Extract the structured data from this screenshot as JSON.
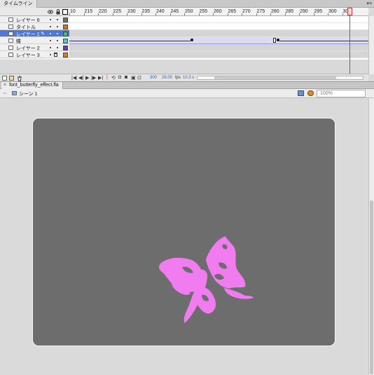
{
  "timeline": {
    "tab_title": "タイムライン",
    "panel_menu": "▾≡",
    "ruler_labels": [
      "10",
      "215",
      "220",
      "225",
      "230",
      "235",
      "240",
      "245",
      "250",
      "255",
      "260",
      "265",
      "270",
      "275",
      "280",
      "285",
      "290",
      "295",
      "300",
      "30"
    ],
    "layers": [
      {
        "name": "レイヤー 6",
        "color": "#6e6e6e"
      },
      {
        "name": "タイトル",
        "color": "#e06c1e"
      },
      {
        "name": "レイヤー 1",
        "color": "#40c060",
        "selected": true
      },
      {
        "name": "蝶",
        "color": "#40d0d0"
      },
      {
        "name": "レイヤー 2",
        "color": "#7a2ec8"
      },
      {
        "name": "レイヤー 3",
        "color": "#e07a1e"
      }
    ],
    "current_frame": "300",
    "frame_rate": "29.00",
    "frame_rate_unit": "fps",
    "elapsed_time": "10.3 s",
    "playhead_frame": 300
  },
  "document": {
    "tab_title": "font_butterfly_effect.fla",
    "close_glyph": "×",
    "scene_label": "シーン 1",
    "zoom": "100%"
  },
  "colors": {
    "stage": "#6d6d6d",
    "butterfly": "#f07cf0",
    "selection": "#4f77d9",
    "playhead": "#dd3333"
  }
}
